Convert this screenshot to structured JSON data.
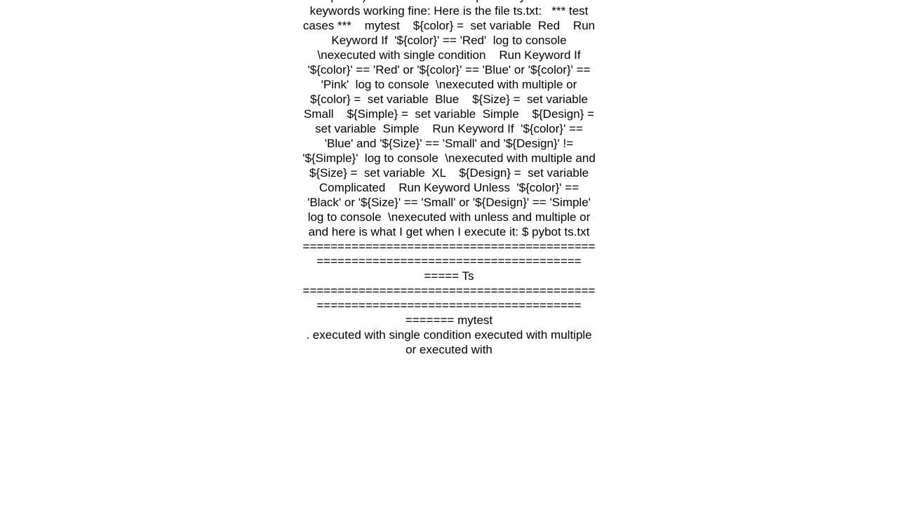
{
  "page": {
    "background_color": "#ffffff",
    "text_color": "#000000"
  },
  "content": {
    "body_text": "spaces). Here is a code sample with your three keywords working fine: Here is the file ts.txt:   *** test cases ***    mytest    ${color} =  set variable  Red    Run Keyword If  '${color}' == 'Red'  log to console  \\nexecuted with single condition    Run Keyword If  '${color}' == 'Red' or '${color}' == 'Blue' or '${color}' == 'Pink'  log to console  \\nexecuted with multiple or    ${color} =  set variable  Blue    ${Size} =  set variable  Small    ${Simple} =  set variable  Simple    ${Design} =  set variable  Simple    Run Keyword If  '${color}' == 'Blue' and '${Size}' == 'Small' and '${Design}' != '${Simple}'  log to console  \\nexecuted with multiple and     ${Size} =  set variable  XL    ${Design} =  set variable  Complicated    Run Keyword Unless  '${color}' == 'Black' or '${Size}' == 'Small' or '${Design}' == 'Simple'  log to console  \\nexecuted with unless and multiple or  and here is what I get when I execute it: $ pybot ts.txt ================================================================================ ===== Ts ================================================================================ ======= mytest                                                                . executed with single condition executed with multiple or executed with"
  }
}
